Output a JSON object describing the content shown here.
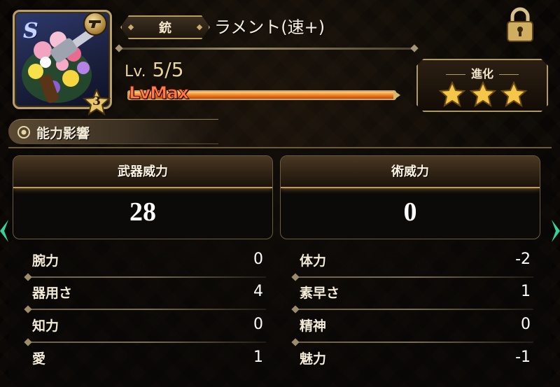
{
  "item": {
    "rarity_letter": "S",
    "category_label": "銃",
    "name": "ラメント(速+)",
    "rank": "3",
    "level_prefix": "Lv.",
    "level_value": "5/5",
    "exp_label": "LvMax",
    "exp_progress": 1.0
  },
  "evolution": {
    "title": "進化",
    "stars_filled": 3,
    "stars_total": 3
  },
  "section": {
    "title": "能力影響"
  },
  "power": {
    "weapon_label": "武器威力",
    "weapon_value": "28",
    "art_label": "術威力",
    "art_value": "0"
  },
  "stats_left": [
    {
      "name": "腕力",
      "value": "0"
    },
    {
      "name": "器用さ",
      "value": "4"
    },
    {
      "name": "知力",
      "value": "0"
    },
    {
      "name": "愛",
      "value": "1"
    }
  ],
  "stats_right": [
    {
      "name": "体力",
      "value": "-2"
    },
    {
      "name": "素早さ",
      "value": "1"
    },
    {
      "name": "精神",
      "value": "0"
    },
    {
      "name": "魅力",
      "value": "-1"
    }
  ],
  "icons": {
    "lock": "lock-icon",
    "type": "gun-icon",
    "section": "gear-icon",
    "star": "star-icon"
  },
  "colors": {
    "accent_gold": "#c9a86a",
    "exp_fill": "#f07a1c",
    "exp_label": "#ff7a4d",
    "star_gold": "#f4c64a",
    "side_arrow": "#34d39a"
  }
}
